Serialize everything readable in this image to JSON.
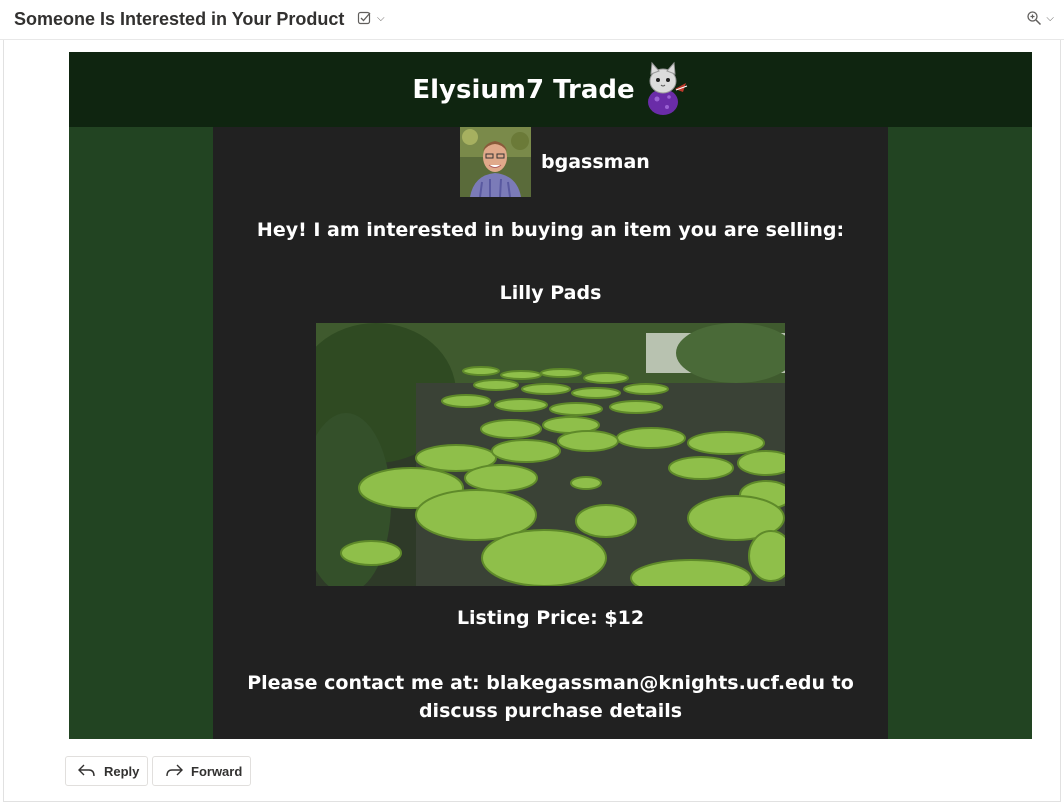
{
  "mail": {
    "subject": "Someone Is Interested in Your Product"
  },
  "email": {
    "brand_title": "Elysium7 Trade",
    "username": "bgassman",
    "greeting": "Hey! I am interested in buying an item you are selling:",
    "item_name": "Lilly Pads",
    "price_text": "Listing Price: $12",
    "contact_text": "Please contact me at: blakegassman@knights.ucf.edu to discuss purchase details"
  },
  "actions": {
    "reply_label": "Reply",
    "forward_label": "Forward"
  },
  "colors": {
    "header_bg": "#0f2510",
    "side_bg": "#224422",
    "content_bg": "#212121"
  },
  "icons": [
    "tag-icon",
    "chevron-down-icon",
    "zoom-icon",
    "reply-icon",
    "forward-icon"
  ]
}
